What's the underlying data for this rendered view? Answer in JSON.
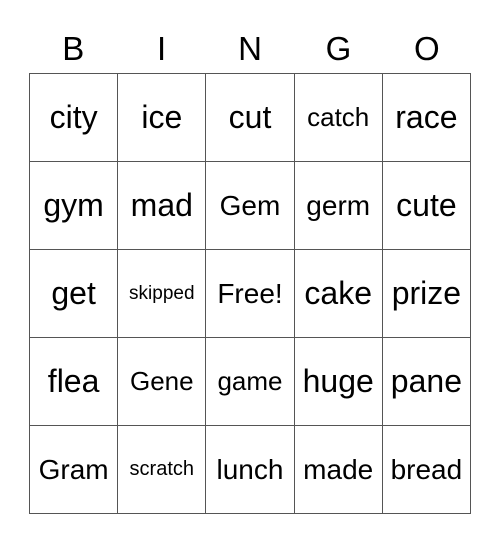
{
  "header": [
    "B",
    "I",
    "N",
    "G",
    "O"
  ],
  "cells": [
    [
      "city",
      "ice",
      "cut",
      "catch",
      "race"
    ],
    [
      "gym",
      "mad",
      "Gem",
      "germ",
      "cute"
    ],
    [
      "get",
      "skipped",
      "Free!",
      "cake",
      "prize"
    ],
    [
      "flea",
      "Gene",
      "game",
      "huge",
      "pane"
    ],
    [
      "Gram",
      "scratch",
      "lunch",
      "made",
      "bread"
    ]
  ]
}
